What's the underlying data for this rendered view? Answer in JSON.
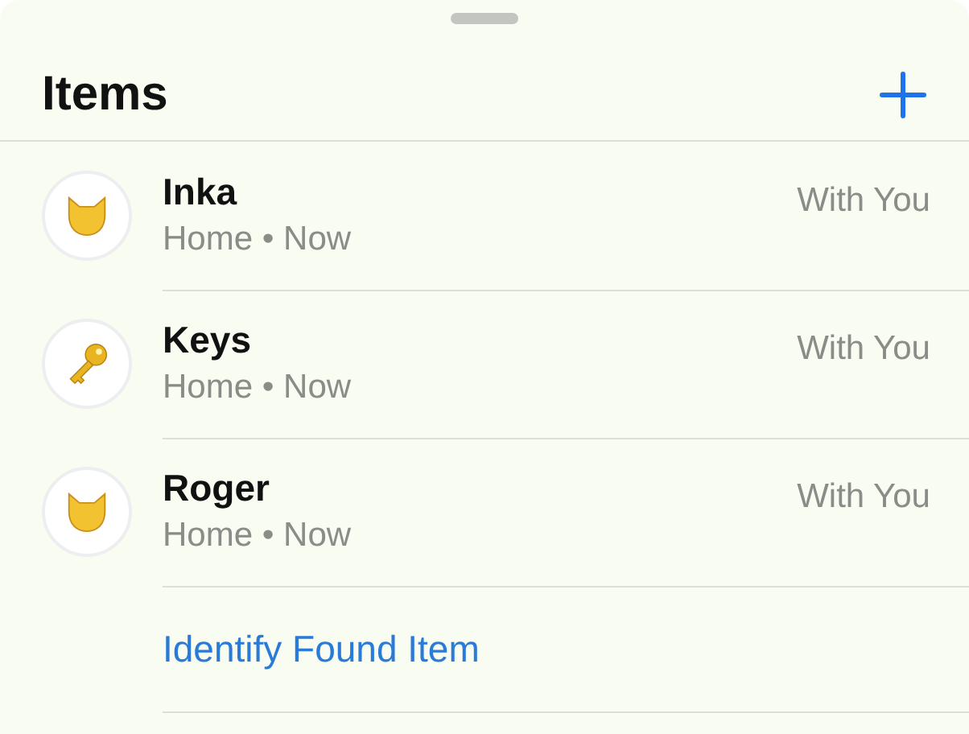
{
  "title": "Items",
  "items": [
    {
      "name": "Inka",
      "subtitle": "Home • Now",
      "status": "With You",
      "kind": "cat"
    },
    {
      "name": "Keys",
      "subtitle": "Home • Now",
      "status": "With You",
      "kind": "key"
    },
    {
      "name": "Roger",
      "subtitle": "Home • Now",
      "status": "With You",
      "kind": "cat"
    }
  ],
  "link": "Identify Found Item"
}
